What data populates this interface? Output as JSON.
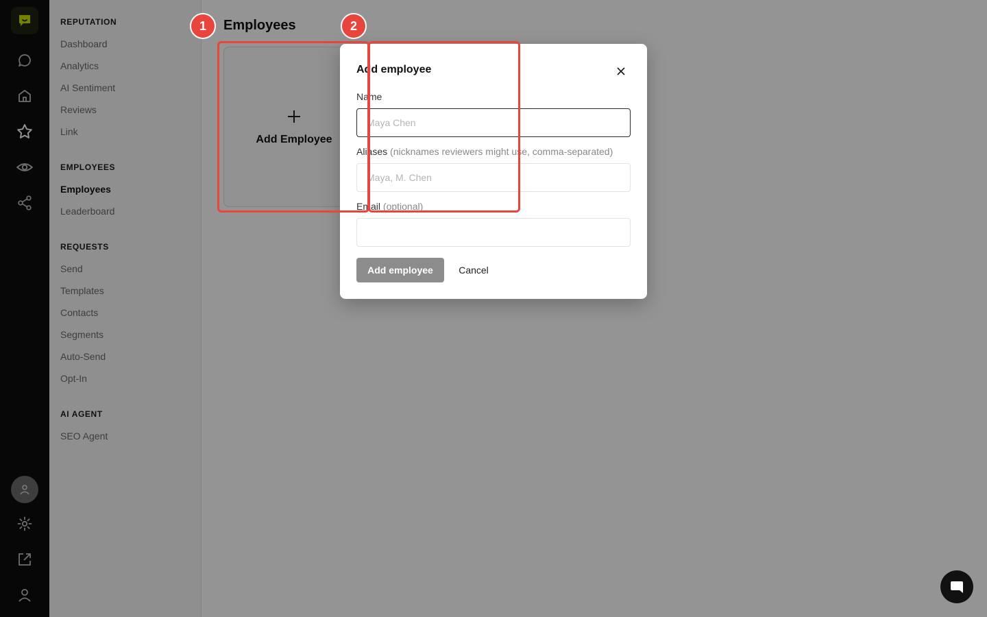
{
  "sidebar": {
    "sections": [
      {
        "title": "REPUTATION",
        "items": [
          "Dashboard",
          "Analytics",
          "AI Sentiment",
          "Reviews",
          "Link"
        ]
      },
      {
        "title": "EMPLOYEES",
        "items": [
          "Employees",
          "Leaderboard"
        ]
      },
      {
        "title": "REQUESTS",
        "items": [
          "Send",
          "Templates",
          "Contacts",
          "Segments",
          "Auto-Send",
          "Opt-In"
        ]
      },
      {
        "title": "AI AGENT",
        "items": [
          "SEO Agent"
        ]
      }
    ],
    "active_item": "Employees"
  },
  "rail_icons": [
    "chat-icon",
    "home-icon",
    "star-icon",
    "eye-icon",
    "share-icon",
    "settings-icon",
    "external-link-icon",
    "user-icon"
  ],
  "main": {
    "page_title": "Employees",
    "add_card_label": "Add Employee"
  },
  "modal": {
    "title": "Add employee",
    "name_label": "Name",
    "name_placeholder": "Maya Chen",
    "aliases_label": "Aliases",
    "aliases_hint": "(nicknames reviewers might use, comma-separated)",
    "aliases_placeholder": "Maya, M. Chen",
    "email_label": "Email",
    "email_hint": "(optional)",
    "email_value": "",
    "submit_label": "Add employee",
    "cancel_label": "Cancel"
  },
  "annotations": [
    {
      "label": "1"
    },
    {
      "label": "2"
    }
  ],
  "colors": {
    "rail_bg": "#0d0d0d",
    "logo_accent": "#c8e000",
    "annotation": "#e8453c",
    "primary_button_disabled": "#8c8c8c"
  }
}
